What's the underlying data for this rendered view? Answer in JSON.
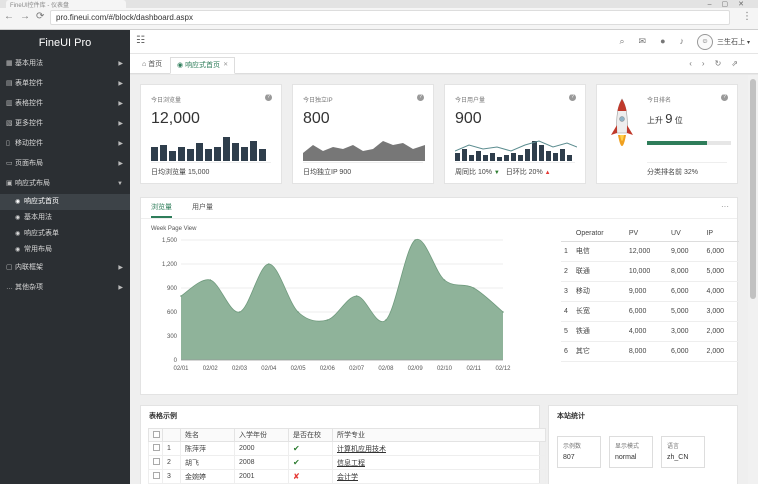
{
  "browser": {
    "tab_title": "FineUI控件库 - 仪表盘",
    "url": "pro.fineui.com/#/block/dashboard.aspx",
    "nav_icons": [
      "back-icon",
      "forward-icon",
      "reload-icon"
    ]
  },
  "sidebar": {
    "brand": "FineUI Pro",
    "items": [
      {
        "label": "基本用法"
      },
      {
        "label": "表单控件"
      },
      {
        "label": "表格控件"
      },
      {
        "label": "更多控件"
      },
      {
        "label": "移动控件"
      },
      {
        "label": "页面布局"
      },
      {
        "label": "响应式布局"
      }
    ],
    "subitems": [
      {
        "label": "响应式首页"
      },
      {
        "label": "基本用法"
      },
      {
        "label": "响应式表单"
      },
      {
        "label": "常用布局"
      }
    ],
    "items_after": [
      {
        "label": "内联框架"
      },
      {
        "label": "其他杂项"
      }
    ]
  },
  "topbar": {
    "user_name": "三生石上",
    "icons": [
      "search-icon",
      "mail-icon",
      "chat-icon",
      "bell-icon"
    ]
  },
  "tabs": {
    "home": "首页",
    "active": "响应式首页"
  },
  "stats": {
    "visits": {
      "title": "今日浏览量",
      "value": "12,000",
      "footer": "日均浏览量 15,000"
    },
    "ip": {
      "title": "今日独立IP",
      "value": "800",
      "footer": "日均独立IP 900"
    },
    "users": {
      "title": "今日用户量",
      "value": "900",
      "wow": "周同比 10%",
      "dod": "日环比 20%"
    },
    "rank": {
      "title": "今日排名",
      "prefix": "上升",
      "value": "9",
      "suffix": "位",
      "footer": "分类排名前 32%",
      "progress": 0.72
    }
  },
  "chart_tabs": {
    "tab1": "浏览量",
    "tab2": "用户量"
  },
  "chart_data": {
    "type": "area",
    "title": "Week Page View",
    "categories": [
      "02/01",
      "02/02",
      "02/03",
      "02/04",
      "02/05",
      "02/06",
      "02/07",
      "02/08",
      "02/09",
      "02/10",
      "02/11",
      "02/12"
    ],
    "values": [
      800,
      1000,
      600,
      1200,
      600,
      500,
      800,
      500,
      1500,
      1000,
      900,
      600
    ],
    "ylim": [
      0,
      1500
    ],
    "yticks": [
      "1,500",
      "1,200",
      "900",
      "600",
      "300",
      "0"
    ],
    "color": "#8fb39a"
  },
  "ops_table": {
    "headers": [
      "",
      "Operator",
      "PV",
      "UV",
      "IP"
    ],
    "rows": [
      [
        "1",
        "电信",
        "12,000",
        "9,000",
        "6,000"
      ],
      [
        "2",
        "联通",
        "10,000",
        "8,000",
        "5,000"
      ],
      [
        "3",
        "移动",
        "9,000",
        "6,000",
        "4,000"
      ],
      [
        "4",
        "长宽",
        "6,000",
        "5,000",
        "3,000"
      ],
      [
        "5",
        "铁通",
        "4,000",
        "3,000",
        "2,000"
      ],
      [
        "6",
        "其它",
        "8,000",
        "6,000",
        "2,000"
      ]
    ]
  },
  "students": {
    "title": "表格示例",
    "headers": [
      "",
      "",
      "姓名",
      "入学年份",
      "是否在校",
      "所学专业"
    ],
    "rows": [
      {
        "idx": "1",
        "name": "陈萍萍",
        "year": "2000",
        "inschool": true,
        "major": "计算机应用技术"
      },
      {
        "idx": "2",
        "name": "胡飞",
        "year": "2008",
        "inschool": true,
        "major": "信息工程"
      },
      {
        "idx": "3",
        "name": "金婉婷",
        "year": "2001",
        "inschool": false,
        "major": "会计学"
      }
    ]
  },
  "site_stats": {
    "title": "本站统计",
    "boxes": [
      {
        "label": "示例数",
        "value": "807"
      },
      {
        "label": "显示模式",
        "value": "normal"
      },
      {
        "label": "语言",
        "value": "zh_CN"
      }
    ]
  }
}
